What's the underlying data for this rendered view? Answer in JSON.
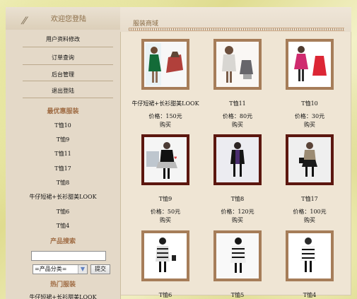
{
  "sidebar": {
    "welcome": "欢迎您登陆",
    "menu": [
      "用户资料修改",
      "订单查询",
      "后台管理",
      "退出登陆"
    ],
    "best_title": "最优惠服装",
    "best_items": [
      "T恤10",
      "T恤9",
      "T恤11",
      "T恤17",
      "T恤8",
      "牛仔短裙+长衫甜美LOOK",
      "T恤6",
      "T恤4"
    ],
    "search_title": "产品搜索",
    "search_placeholder": "",
    "category_default": "=产品分类=",
    "submit_label": "提交",
    "hot_title": "热门服装",
    "hot_items": [
      "牛仔短裙+长衫甜美LOOK"
    ]
  },
  "main": {
    "title": "服装商域",
    "products": [
      {
        "name": "牛仔短裙+长衫甜美LOOK",
        "price": "价格：150元",
        "buy": "购买"
      },
      {
        "name": "T恤11",
        "price": "价格：80元",
        "buy": "购买"
      },
      {
        "name": "T恤10",
        "price": "价格：30元",
        "buy": "购买"
      },
      {
        "name": "T恤9",
        "price": "价格：50元",
        "buy": "购买"
      },
      {
        "name": "T恤8",
        "price": "价格：120元",
        "buy": "购买"
      },
      {
        "name": "T恤17",
        "price": "价格：100元",
        "buy": "购买"
      },
      {
        "name": "T恤6",
        "price": "",
        "buy": ""
      },
      {
        "name": "T恤5",
        "price": "",
        "buy": ""
      },
      {
        "name": "T恤4",
        "price": "",
        "buy": ""
      }
    ]
  },
  "colors": {
    "accent_brown": "#8a6c46",
    "section_brown": "#a06d45",
    "frame_brown": "#a67d59",
    "dark_frame": "#5c170f"
  }
}
